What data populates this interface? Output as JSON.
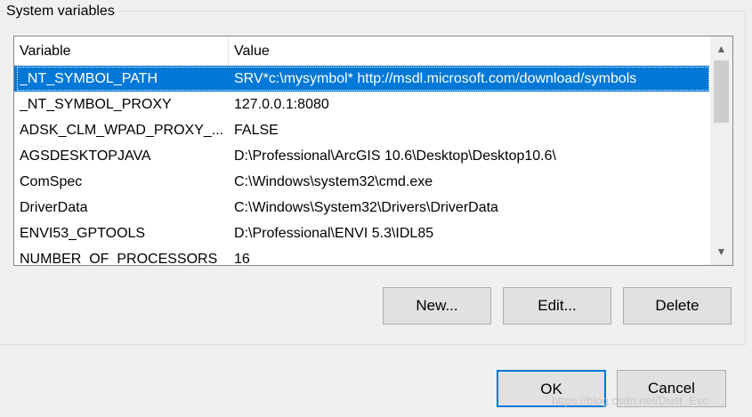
{
  "group": {
    "title": "System variables"
  },
  "list": {
    "headers": {
      "variable": "Variable",
      "value": "Value"
    },
    "rows": [
      {
        "variable": "_NT_SYMBOL_PATH",
        "value": "SRV*c:\\mysymbol* http://msdl.microsoft.com/download/symbols"
      },
      {
        "variable": "_NT_SYMBOL_PROXY",
        "value": "127.0.0.1:8080"
      },
      {
        "variable": "ADSK_CLM_WPAD_PROXY_...",
        "value": "FALSE"
      },
      {
        "variable": "AGSDESKTOPJAVA",
        "value": "D:\\Professional\\ArcGIS 10.6\\Desktop\\Desktop10.6\\"
      },
      {
        "variable": "ComSpec",
        "value": "C:\\Windows\\system32\\cmd.exe"
      },
      {
        "variable": "DriverData",
        "value": "C:\\Windows\\System32\\Drivers\\DriverData"
      },
      {
        "variable": "ENVI53_GPTOOLS",
        "value": "D:\\Professional\\ENVI 5.3\\IDL85"
      },
      {
        "variable": "NUMBER_OF_PROCESSORS",
        "value": "16"
      }
    ],
    "selected_index": 0
  },
  "buttons": {
    "new": "New...",
    "edit": "Edit...",
    "delete": "Delete",
    "ok": "OK",
    "cancel": "Cancel"
  },
  "icons": {
    "scroll_up": "chevron-up-icon",
    "scroll_down": "chevron-down-icon"
  },
  "colors": {
    "selection": "#0078d7",
    "default_button_border": "#0078d7"
  },
  "watermark": "https://blog.csdn.net/Dust_Evc"
}
